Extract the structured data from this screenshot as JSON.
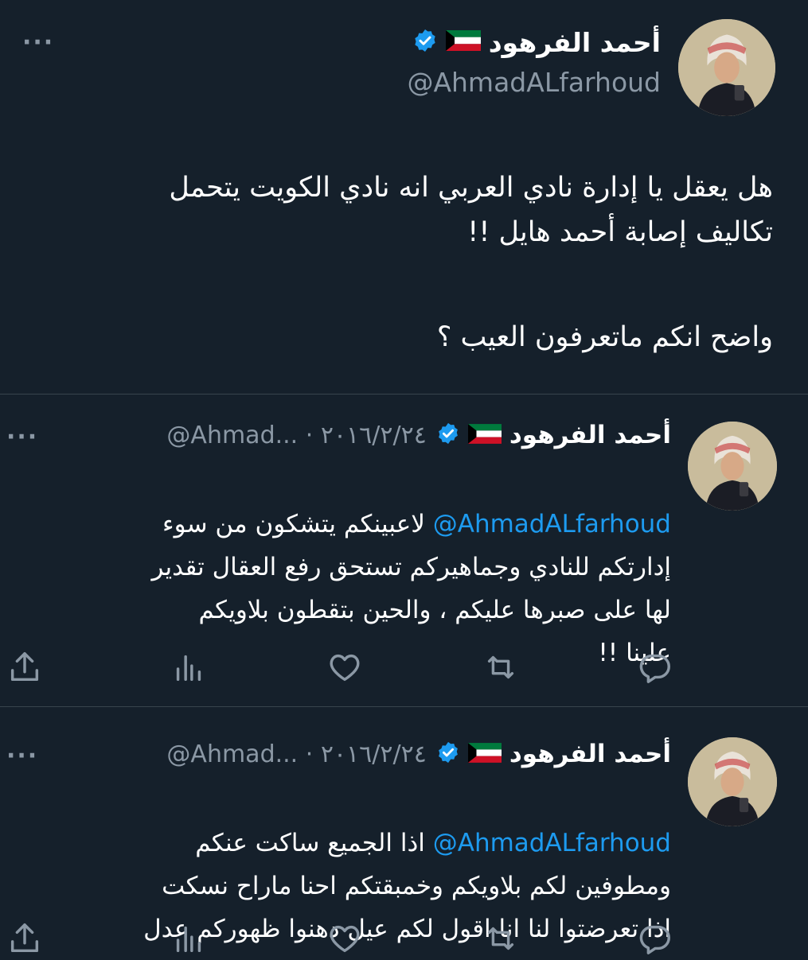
{
  "main_tweet": {
    "display_name": "أحمد الفرهود",
    "handle": "@AhmadALfarhoud",
    "text_paragraph_1": "هل يعقل يا إدارة نادي العربي انه نادي الكويت يتحمل\nتكاليف إصابة أحمد هايل !!",
    "text_paragraph_2": "واضح انكم ماتعرفون العيب ؟",
    "more_label": "···"
  },
  "replies": [
    {
      "display_name": "أحمد الفرهود",
      "meta": "@Ahmad... · ٢٠١٦/٢/٢٤",
      "mention": "@AhmadALfarhoud",
      "text_first": " لاعبينكم يتشكون من سوء",
      "text_rest": "إدارتكم للنادي وجماهيركم تستحق رفع العقال تقدير\nلها على صبرها عليكم ، والحين بتقطون بلاويكم\nعلينا !!",
      "more_label": "···"
    },
    {
      "display_name": "أحمد الفرهود",
      "meta": "@Ahmad... · ٢٠١٦/٢/٢٤",
      "mention": "@AhmadALfarhoud",
      "text_first": " اذا الجميع ساكت عنكم",
      "text_rest": "ومطوفين لكم بلاويكم وخمبقتكم احنا ماراح نسكت\nاذا تعرضتوا لنا انا اقول لكم عيل دهنوا ظهوركم عدل",
      "more_label": "···"
    }
  ],
  "icons": {
    "flag": "kuwait-flag-icon",
    "verified": "verified-badge-icon",
    "reply": "reply-icon",
    "retweet": "retweet-icon",
    "like": "like-icon",
    "views": "views-icon",
    "share": "share-icon"
  },
  "colors": {
    "background": "#15202b",
    "text": "#ffffff",
    "muted": "#8b98a5",
    "link": "#1d9bf0",
    "verified": "#1d9bf0",
    "divider": "#38444d"
  }
}
